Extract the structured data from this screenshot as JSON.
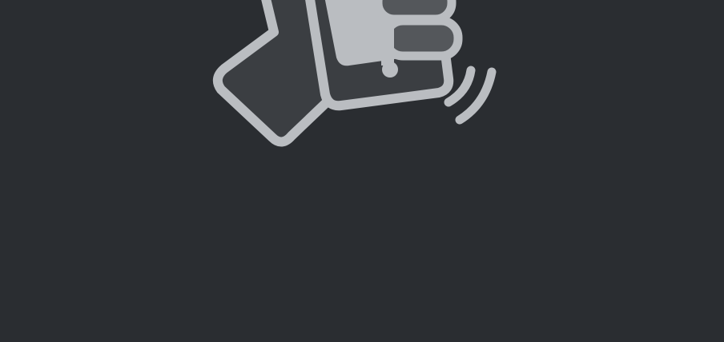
{
  "screen": {
    "illustration": "hand-shaking-phone-icon",
    "colors": {
      "background": "#2a2d31",
      "outline": "#babdc1",
      "fill_dark": "#3b3e42",
      "fill_mid": "#54575b"
    }
  }
}
